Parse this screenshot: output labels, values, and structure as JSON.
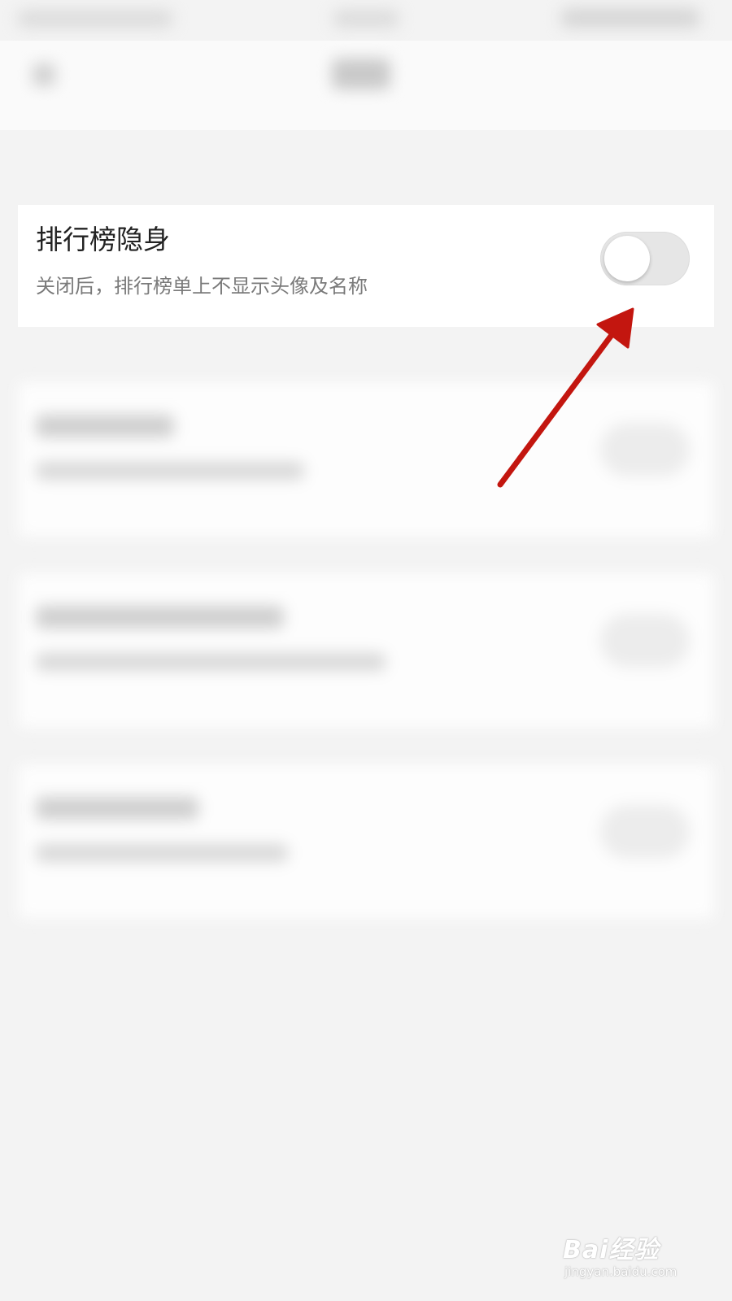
{
  "setting": {
    "title": "排行榜隐身",
    "description": "关闭后，排行榜单上不显示头像及名称",
    "enabled": false
  },
  "watermark": {
    "brand": "Bai经验",
    "url": "jingyan.baidu.com"
  },
  "colors": {
    "background": "#f3f3f3",
    "card": "#ffffff",
    "title_text": "#222222",
    "description_text": "#7a7a7a",
    "toggle_off_track": "#e6e6e6",
    "arrow": "#c3160f"
  }
}
